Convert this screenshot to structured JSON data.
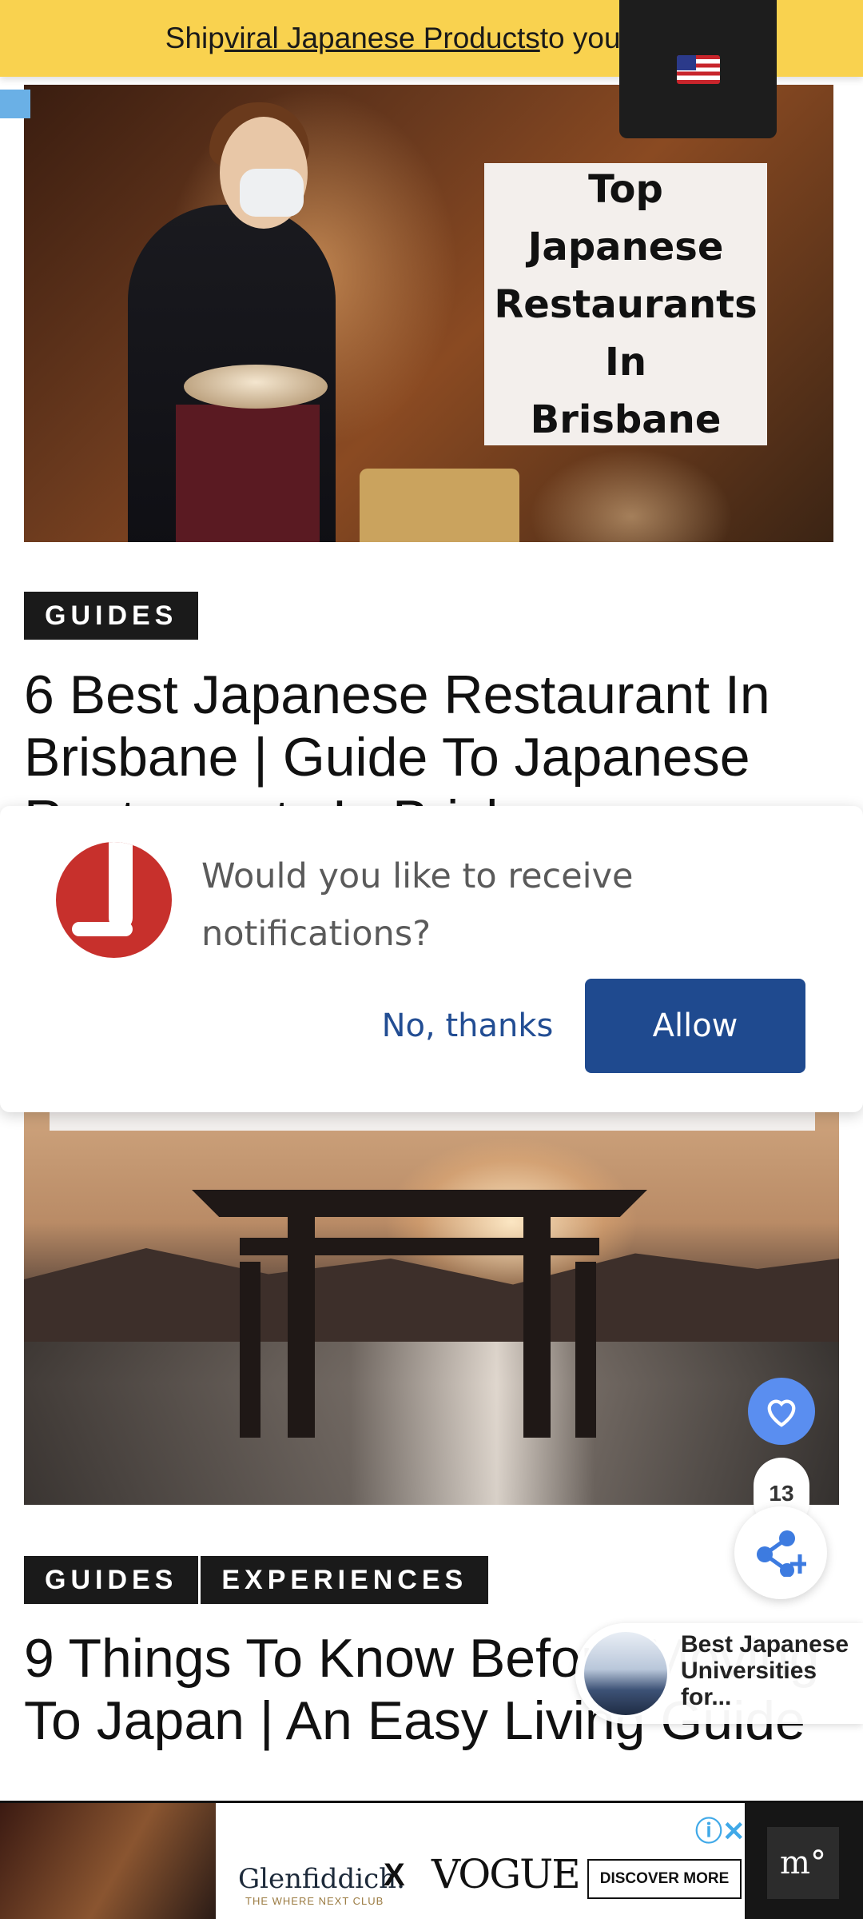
{
  "promo_bar": {
    "prefix": "Ship ",
    "link": "viral Japanese Products ",
    "suffix": "to your door"
  },
  "language": {
    "icon": "us-flag-icon"
  },
  "article1": {
    "image_overlay": [
      "Top",
      "Japanese",
      "Restaurants",
      "In",
      "Brisbane"
    ],
    "tag": "GUIDES",
    "title": "6 Best Japanese Restaurant In Brisbane | Guide To Japanese Restaurants In Brisbane"
  },
  "notification": {
    "message": "Would you like to receive notifications?",
    "deny_label": "No, thanks",
    "allow_label": "Allow"
  },
  "article2": {
    "tags": [
      "GUIDES",
      "EXPERIENCES"
    ],
    "title": "9 Things To Know Before Moving To Japan | An Easy Living Guide"
  },
  "social": {
    "like_count": "13"
  },
  "related": {
    "title": "Best Japanese Universities for..."
  },
  "ad": {
    "brand": "Glenfiddich.",
    "brand_sub": "THE WHERE NEXT CLUB",
    "x": "X",
    "partner": "VOGUE",
    "cta": "DISCOVER MORE"
  },
  "colors": {
    "promo_bg": "#f9d24f",
    "allow_bg": "#1f4a8f",
    "tag_bg": "#1a1a1a",
    "heart_bg": "#5a8ef0"
  }
}
